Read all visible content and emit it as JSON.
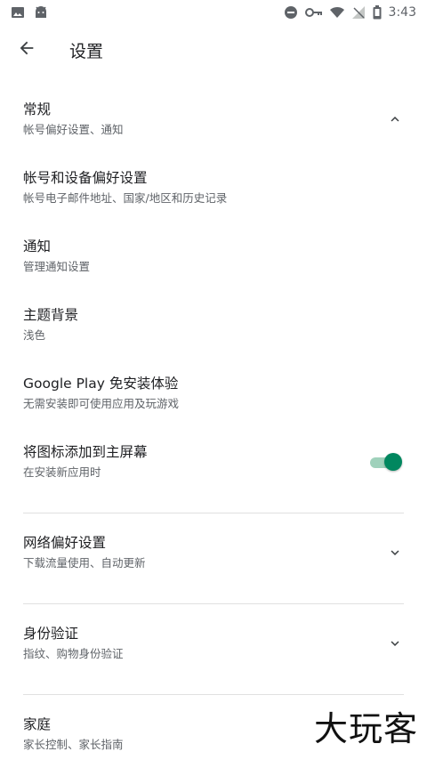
{
  "status_bar": {
    "time": "3:43",
    "left_icons": [
      "image-icon",
      "android-icon"
    ],
    "right_icons": [
      "do-not-disturb-icon",
      "key-icon",
      "wifi-icon",
      "signal-off-icon",
      "battery-icon"
    ]
  },
  "app_bar": {
    "back_icon": "arrow-left-icon",
    "title": "设置"
  },
  "settings": {
    "general": {
      "title": "常规",
      "subtitle": "帐号偏好设置、通知",
      "trail_icon": "chevron-up-icon"
    },
    "account": {
      "title": "帐号和设备偏好设置",
      "subtitle": "帐号电子邮件地址、国家/地区和历史记录"
    },
    "notifications": {
      "title": "通知",
      "subtitle": "管理通知设置"
    },
    "theme": {
      "title": "主题背景",
      "subtitle": "浅色"
    },
    "instant": {
      "title": "Google Play 免安装体验",
      "subtitle": "无需安装即可使用应用及玩游戏"
    },
    "add_icon": {
      "title": "将图标添加到主屏幕",
      "subtitle": "在安装新应用时",
      "toggle_on": true
    },
    "network": {
      "title": "网络偏好设置",
      "subtitle": "下载流量使用、自动更新",
      "trail_icon": "chevron-down-icon"
    },
    "auth": {
      "title": "身份验证",
      "subtitle": "指纹、购物身份验证",
      "trail_icon": "chevron-down-icon"
    },
    "family": {
      "title": "家庭",
      "subtitle": "家长控制、家长指南"
    }
  },
  "colors": {
    "accent": "#01875f",
    "accent_track": "#9fd1bb",
    "text_primary": "#202124",
    "text_secondary": "#5f6368",
    "divider": "#e0e0e0"
  },
  "watermark": "大玩客"
}
